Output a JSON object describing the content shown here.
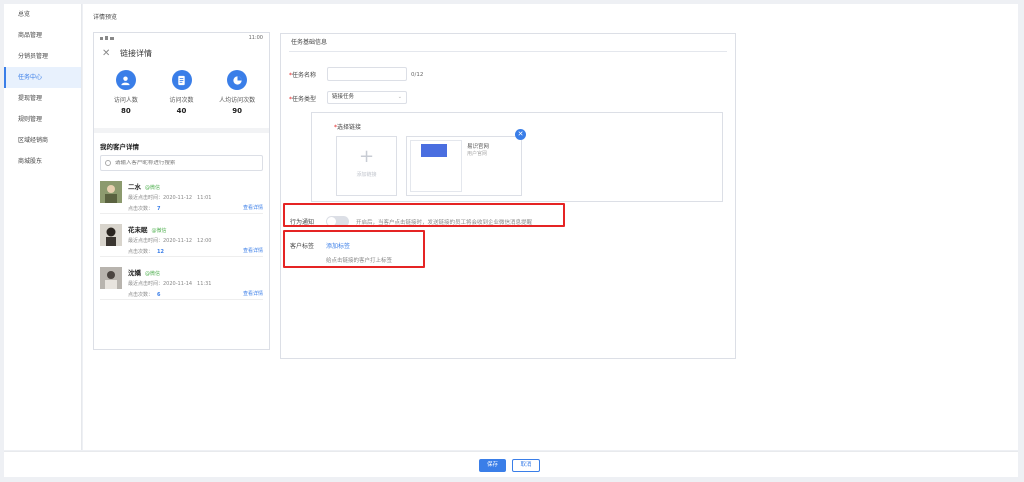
{
  "sidebar": {
    "items": [
      {
        "label": "总览"
      },
      {
        "label": "商品管理"
      },
      {
        "label": "分销员管理"
      },
      {
        "label": "任务中心"
      },
      {
        "label": "提现管理"
      },
      {
        "label": "规则管理"
      },
      {
        "label": "区域经销商"
      },
      {
        "label": "商城股东"
      }
    ],
    "active_index": 3
  },
  "page": {
    "title": "详情预览"
  },
  "phone": {
    "status_time": "11:00",
    "title": "链接详情",
    "stats": [
      {
        "label": "访问人数",
        "value": "80",
        "icon": "person-icon"
      },
      {
        "label": "访问次数",
        "value": "40",
        "icon": "document-icon"
      },
      {
        "label": "人均访问次数",
        "value": "90",
        "icon": "pie-chart-icon"
      }
    ],
    "customers_title": "我的客户详情",
    "search_placeholder": "请输入客户昵称进行搜索",
    "customers": [
      {
        "name": "二水",
        "tag": "@微信",
        "last_click": "最近点击时间：2020-11-12　11:01",
        "clicks_label": "点击次数：",
        "clicks": "7",
        "detail_label": "查看详情"
      },
      {
        "name": "花未眠",
        "tag": "@微信",
        "last_click": "最近点击时间：2020-11-12　12:00",
        "clicks_label": "点击次数：",
        "clicks": "12",
        "detail_label": "查看详情"
      },
      {
        "name": "沈嬌",
        "tag": "@微信",
        "last_click": "最近点击时间：2020-11-14　11:31",
        "clicks_label": "点击次数：",
        "clicks": "6",
        "detail_label": "查看详情"
      }
    ]
  },
  "form": {
    "section_title": "任务基础信息",
    "task_name_label": "任务名称",
    "task_name_value": "",
    "task_name_counter": "0/12",
    "task_type_label": "任务类型",
    "task_type_value": "链接任务",
    "select_link_label": "选择链接",
    "add_link_label": "添加链接",
    "link_card": {
      "title": "易识官网",
      "subtitle": "用户官网"
    },
    "behavior_label": "行为通知",
    "behavior_hint": "开启后，当客户点击链接时，发送链接的员工将会收到企业微信消息提醒",
    "behavior_enabled": false,
    "customer_tag_label": "客户标签",
    "add_tag_label": "添加标签",
    "customer_tag_hint": "给点击链接的客户打上标签"
  },
  "footer": {
    "save_label": "保存",
    "cancel_label": "取消"
  },
  "colors": {
    "accent": "#3a7ee8",
    "highlight": "#e52424",
    "tag_green": "#52b152"
  }
}
